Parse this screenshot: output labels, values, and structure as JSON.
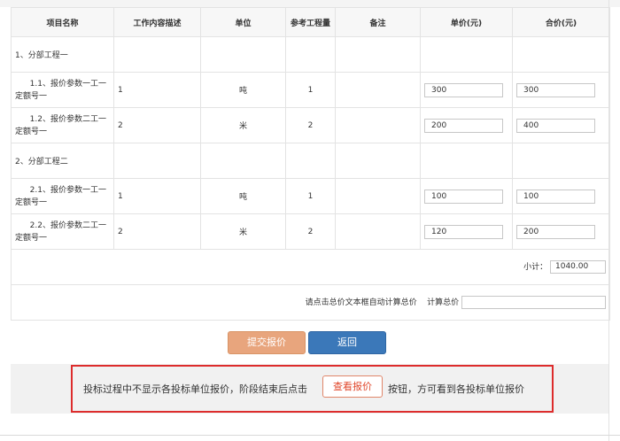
{
  "table": {
    "headers": {
      "name": "项目名称",
      "desc": "工作内容描述",
      "unit": "单位",
      "qty": "参考工程量",
      "remark": "备注",
      "unit_price": "单价(元)",
      "total_price": "合价(元)"
    },
    "sections": [
      {
        "title": "1、分部工程一",
        "items": [
          {
            "name_line1": "1.1、报价参数一工一",
            "name_line2": "定额号一",
            "desc": "1",
            "unit": "吨",
            "qty": "1",
            "remark": "",
            "unit_price": "300",
            "total_price": "300"
          },
          {
            "name_line1": "1.2、报价参数二工一",
            "name_line2": "定额号一",
            "desc": "2",
            "unit": "米",
            "qty": "2",
            "remark": "",
            "unit_price": "200",
            "total_price": "400"
          }
        ]
      },
      {
        "title": "2、分部工程二",
        "items": [
          {
            "name_line1": "2.1、报价参数一工一",
            "name_line2": "定额号一",
            "desc": "1",
            "unit": "吨",
            "qty": "1",
            "remark": "",
            "unit_price": "100",
            "total_price": "100"
          },
          {
            "name_line1": "2.2、报价参数二工一",
            "name_line2": "定额号一",
            "desc": "2",
            "unit": "米",
            "qty": "2",
            "remark": "",
            "unit_price": "120",
            "total_price": "200"
          }
        ]
      }
    ],
    "subtotal_label": "小计：",
    "subtotal_value": "1040.00",
    "calc_hint": "请点击总价文本框自动计算总价",
    "calc_label": "计算总价",
    "calc_value": ""
  },
  "buttons": {
    "submit": "提交报价",
    "back": "返回"
  },
  "notice": {
    "text_before": "投标过程中不显示各投标单位报价，阶段结束后点击",
    "view_button": "查看报价",
    "text_after": "按钮，方可看到各投标单位报价"
  },
  "colors": {
    "submit_bg": "#e8a57d",
    "back_bg": "#3b78b9",
    "notice_border": "#dd2c2c",
    "view_text": "#e0462a"
  }
}
